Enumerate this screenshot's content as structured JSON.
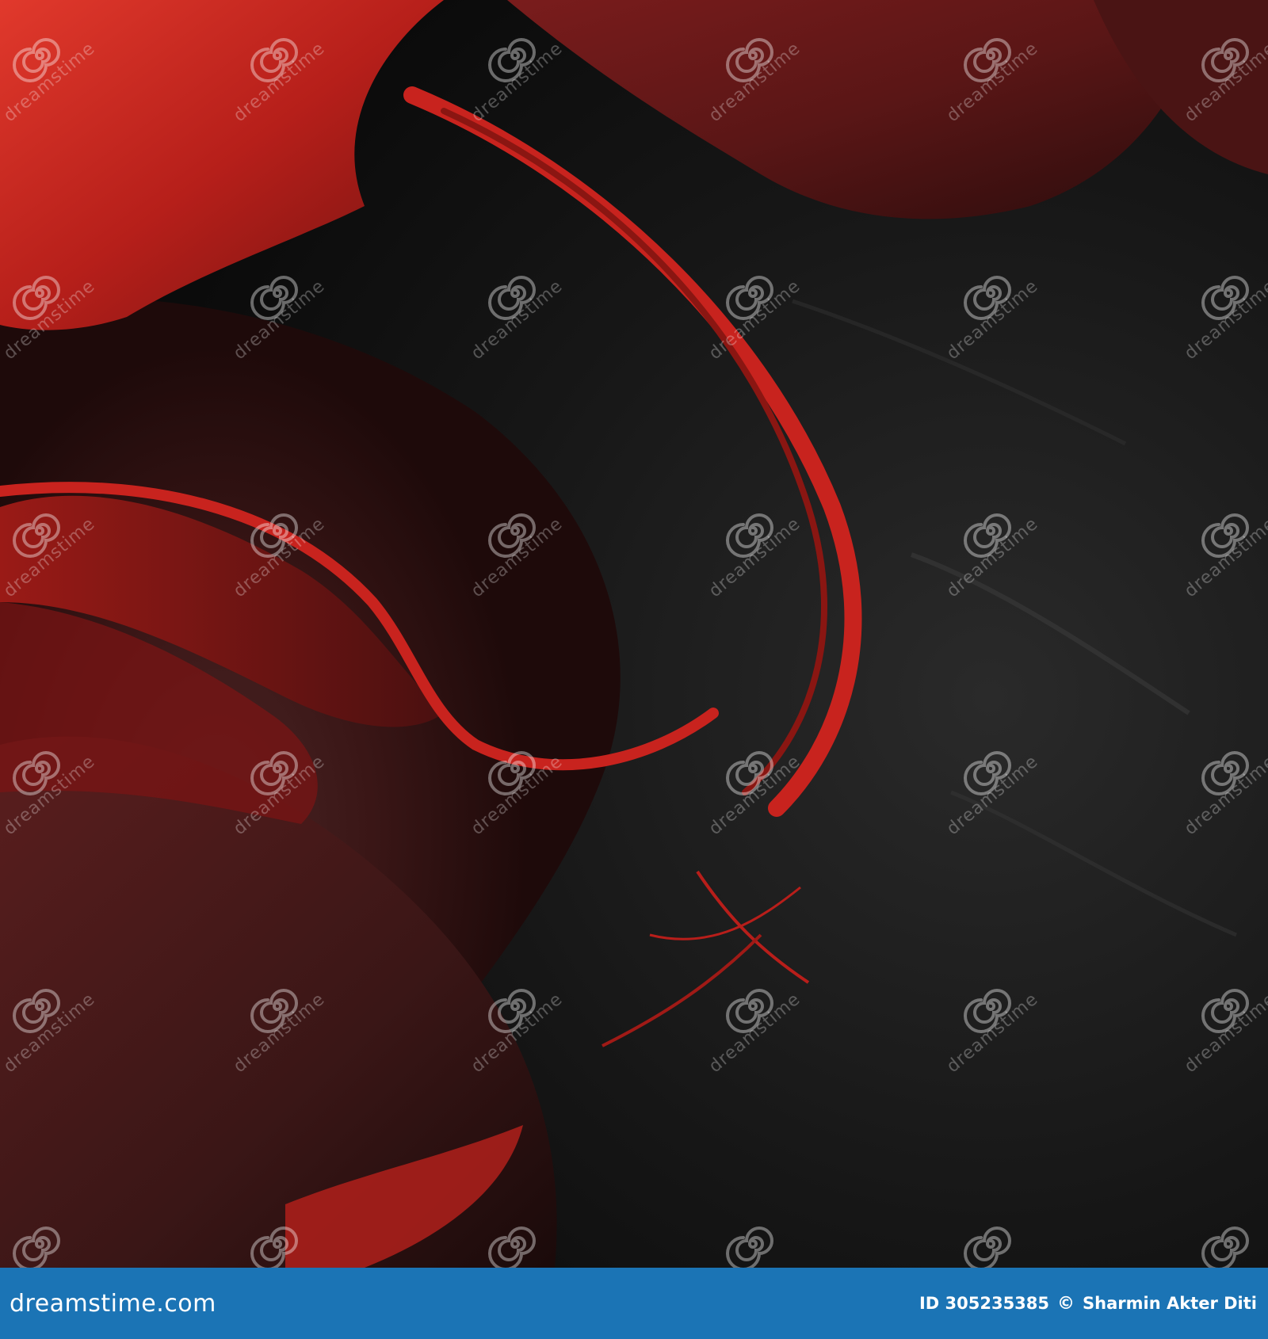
{
  "watermark": {
    "text": "dreamstime",
    "icon": "spiral-icon"
  },
  "footer": {
    "brand": "dreamstime.com",
    "image_id": "ID 305235385",
    "copyright_symbol": "©",
    "author": "Sharmin  Akter Diti",
    "background_color": "#1b74b5"
  },
  "colors": {
    "crimson": "#c8231e",
    "dark_red": "#5a1212",
    "maroon": "#3a1a1a",
    "charcoal": "#1a1a1a"
  }
}
